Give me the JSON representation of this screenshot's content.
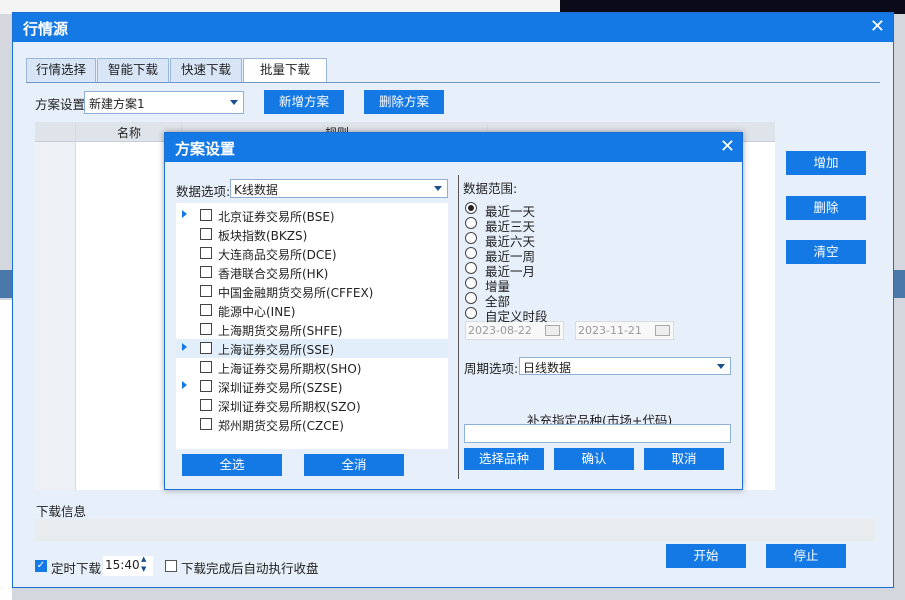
{
  "window": {
    "title": "行情源"
  },
  "tabs": [
    {
      "label": "行情选择"
    },
    {
      "label": "智能下载"
    },
    {
      "label": "快速下载"
    },
    {
      "label": "批量下载"
    }
  ],
  "scheme": {
    "label": "方案设置",
    "value": "新建方案1",
    "new_button": "新增方案",
    "delete_button": "删除方案"
  },
  "table": {
    "columns": [
      "名称",
      "规则"
    ]
  },
  "side_buttons": {
    "add": "增加",
    "remove": "删除",
    "clear": "清空"
  },
  "download_info": {
    "label": "下载信息"
  },
  "bottom": {
    "timer_label": "定时下载",
    "time": "15:40",
    "auto_label": "下载完成后自动执行收盘",
    "start": "开始",
    "stop": "停止"
  },
  "dialog": {
    "title": "方案设置",
    "data_option_label": "数据选项:",
    "data_option_value": "K线数据",
    "exchanges": [
      {
        "name": "北京证券交易所(BSE)",
        "expandable": true,
        "selected": false
      },
      {
        "name": "板块指数(BKZS)",
        "expandable": false,
        "selected": false
      },
      {
        "name": "大连商品交易所(DCE)",
        "expandable": false,
        "selected": false
      },
      {
        "name": "香港联合交易所(HK)",
        "expandable": false,
        "selected": false
      },
      {
        "name": "中国金融期货交易所(CFFEX)",
        "expandable": false,
        "selected": false
      },
      {
        "name": "能源中心(INE)",
        "expandable": false,
        "selected": false
      },
      {
        "name": "上海期货交易所(SHFE)",
        "expandable": false,
        "selected": false
      },
      {
        "name": "上海证券交易所(SSE)",
        "expandable": true,
        "selected": true
      },
      {
        "name": "上海证券交易所期权(SHO)",
        "expandable": false,
        "selected": false
      },
      {
        "name": "深圳证券交易所(SZSE)",
        "expandable": true,
        "selected": false
      },
      {
        "name": "深圳证券交易所期权(SZO)",
        "expandable": false,
        "selected": false
      },
      {
        "name": "郑州期货交易所(CZCE)",
        "expandable": false,
        "selected": false
      }
    ],
    "select_all": "全选",
    "deselect_all": "全消",
    "range_label": "数据范围:",
    "range_options": [
      {
        "label": "最近一天",
        "checked": true
      },
      {
        "label": "最近三天",
        "checked": false
      },
      {
        "label": "最近六天",
        "checked": false
      },
      {
        "label": "最近一周",
        "checked": false
      },
      {
        "label": "最近一月",
        "checked": false
      },
      {
        "label": "增量",
        "checked": false
      },
      {
        "label": "全部",
        "checked": false
      },
      {
        "label": "自定义时段",
        "checked": false
      }
    ],
    "start_date": "2023-08-22",
    "end_date": "2023-11-21",
    "period_label": "周期选项:",
    "period_value": "日线数据",
    "extra_label": "补充指定品种(市场+代码)",
    "extra_value": "",
    "choose_button": "选择品种",
    "confirm_button": "确认",
    "cancel_button": "取消"
  },
  "colors": {
    "accent": "#1479e5",
    "panel": "#e7effa"
  }
}
